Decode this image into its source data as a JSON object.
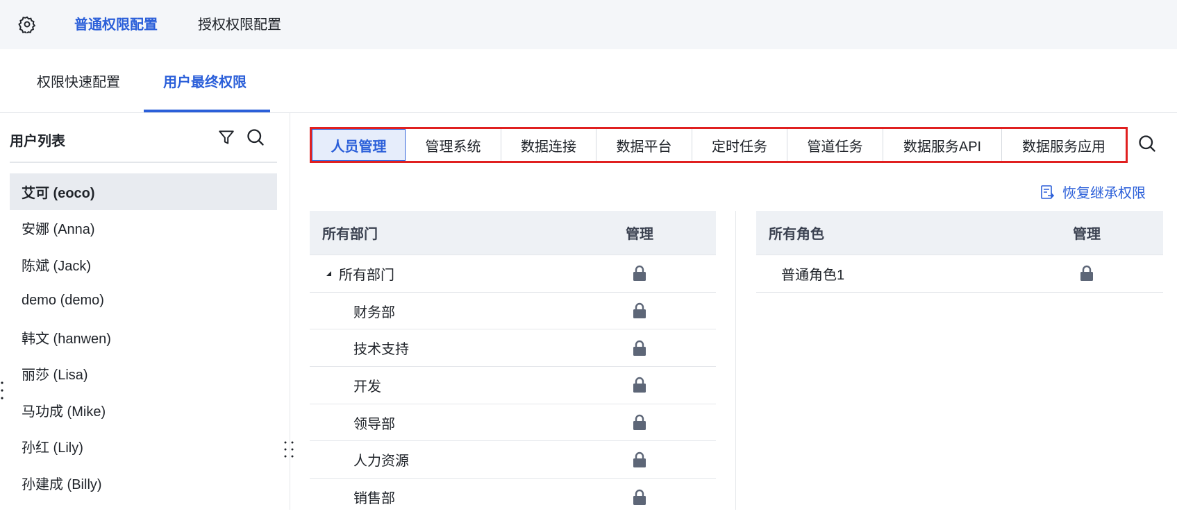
{
  "topbar": {
    "tabs": [
      "普通权限配置",
      "授权权限配置"
    ]
  },
  "subtabs": [
    "权限快速配置",
    "用户最终权限"
  ],
  "left": {
    "title": "用户列表",
    "users": [
      "艾可 (eoco)",
      "安娜 (Anna)",
      "陈斌 (Jack)",
      "demo (demo)",
      "韩文 (hanwen)",
      "丽莎 (Lisa)",
      "马功成 (Mike)",
      "孙红 (Lily)",
      "孙建成 (Billy)"
    ]
  },
  "modules": [
    "人员管理",
    "管理系统",
    "数据连接",
    "数据平台",
    "定时任务",
    "管道任务",
    "数据服务API",
    "数据服务应用"
  ],
  "restore_label": "恢复继承权限",
  "dept_table": {
    "col1": "所有部门",
    "col2": "管理",
    "rows": [
      "所有部门",
      "财务部",
      "技术支持",
      "开发",
      "领导部",
      "人力资源",
      "销售部"
    ]
  },
  "role_table": {
    "col1": "所有角色",
    "col2": "管理",
    "rows": [
      "普通角色1"
    ]
  },
  "colors": {
    "accent": "#2b5fd9",
    "highlight_border": "#e02020"
  }
}
